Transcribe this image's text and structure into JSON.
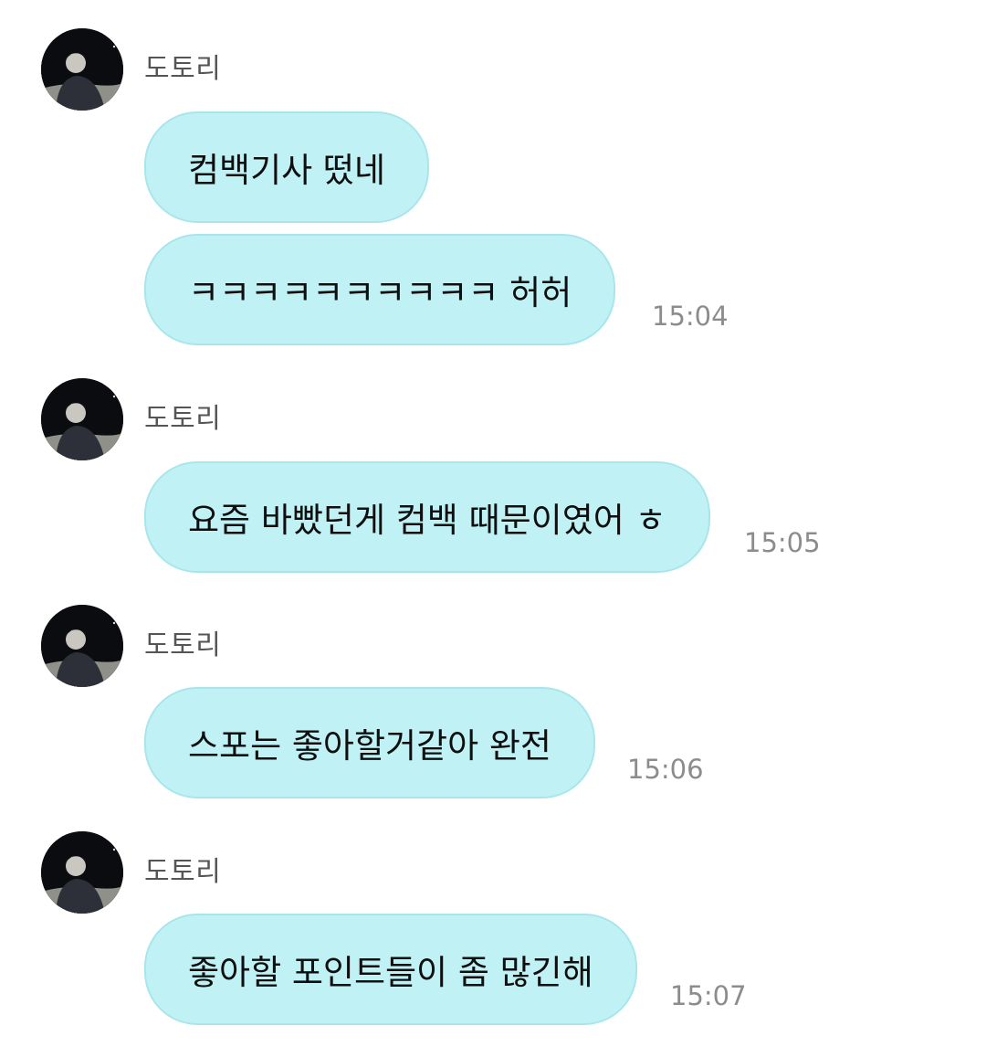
{
  "chat": {
    "groups": [
      {
        "sender": "도토리",
        "messages": [
          {
            "text": "컴백기사 떴네"
          },
          {
            "text": "ㅋㅋㅋㅋㅋㅋㅋㅋㅋㅋ 허허",
            "time": "15:04"
          }
        ]
      },
      {
        "sender": "도토리",
        "messages": [
          {
            "text": "요즘 바빴던게 컴백 때문이였어 ㅎ",
            "time": "15:05"
          }
        ]
      },
      {
        "sender": "도토리",
        "messages": [
          {
            "text": "스포는 좋아할거같아 완전",
            "time": "15:06"
          }
        ]
      },
      {
        "sender": "도토리",
        "messages": [
          {
            "text": "좋아할 포인트들이 좀 많긴해",
            "time": "15:07"
          }
        ]
      }
    ]
  },
  "colors": {
    "bubble": "#bff1f5",
    "bubble_border": "#a9e6ec",
    "timestamp": "#8c8c8c",
    "sender": "#555555"
  },
  "icons": {
    "avatar": "profile-photo"
  }
}
